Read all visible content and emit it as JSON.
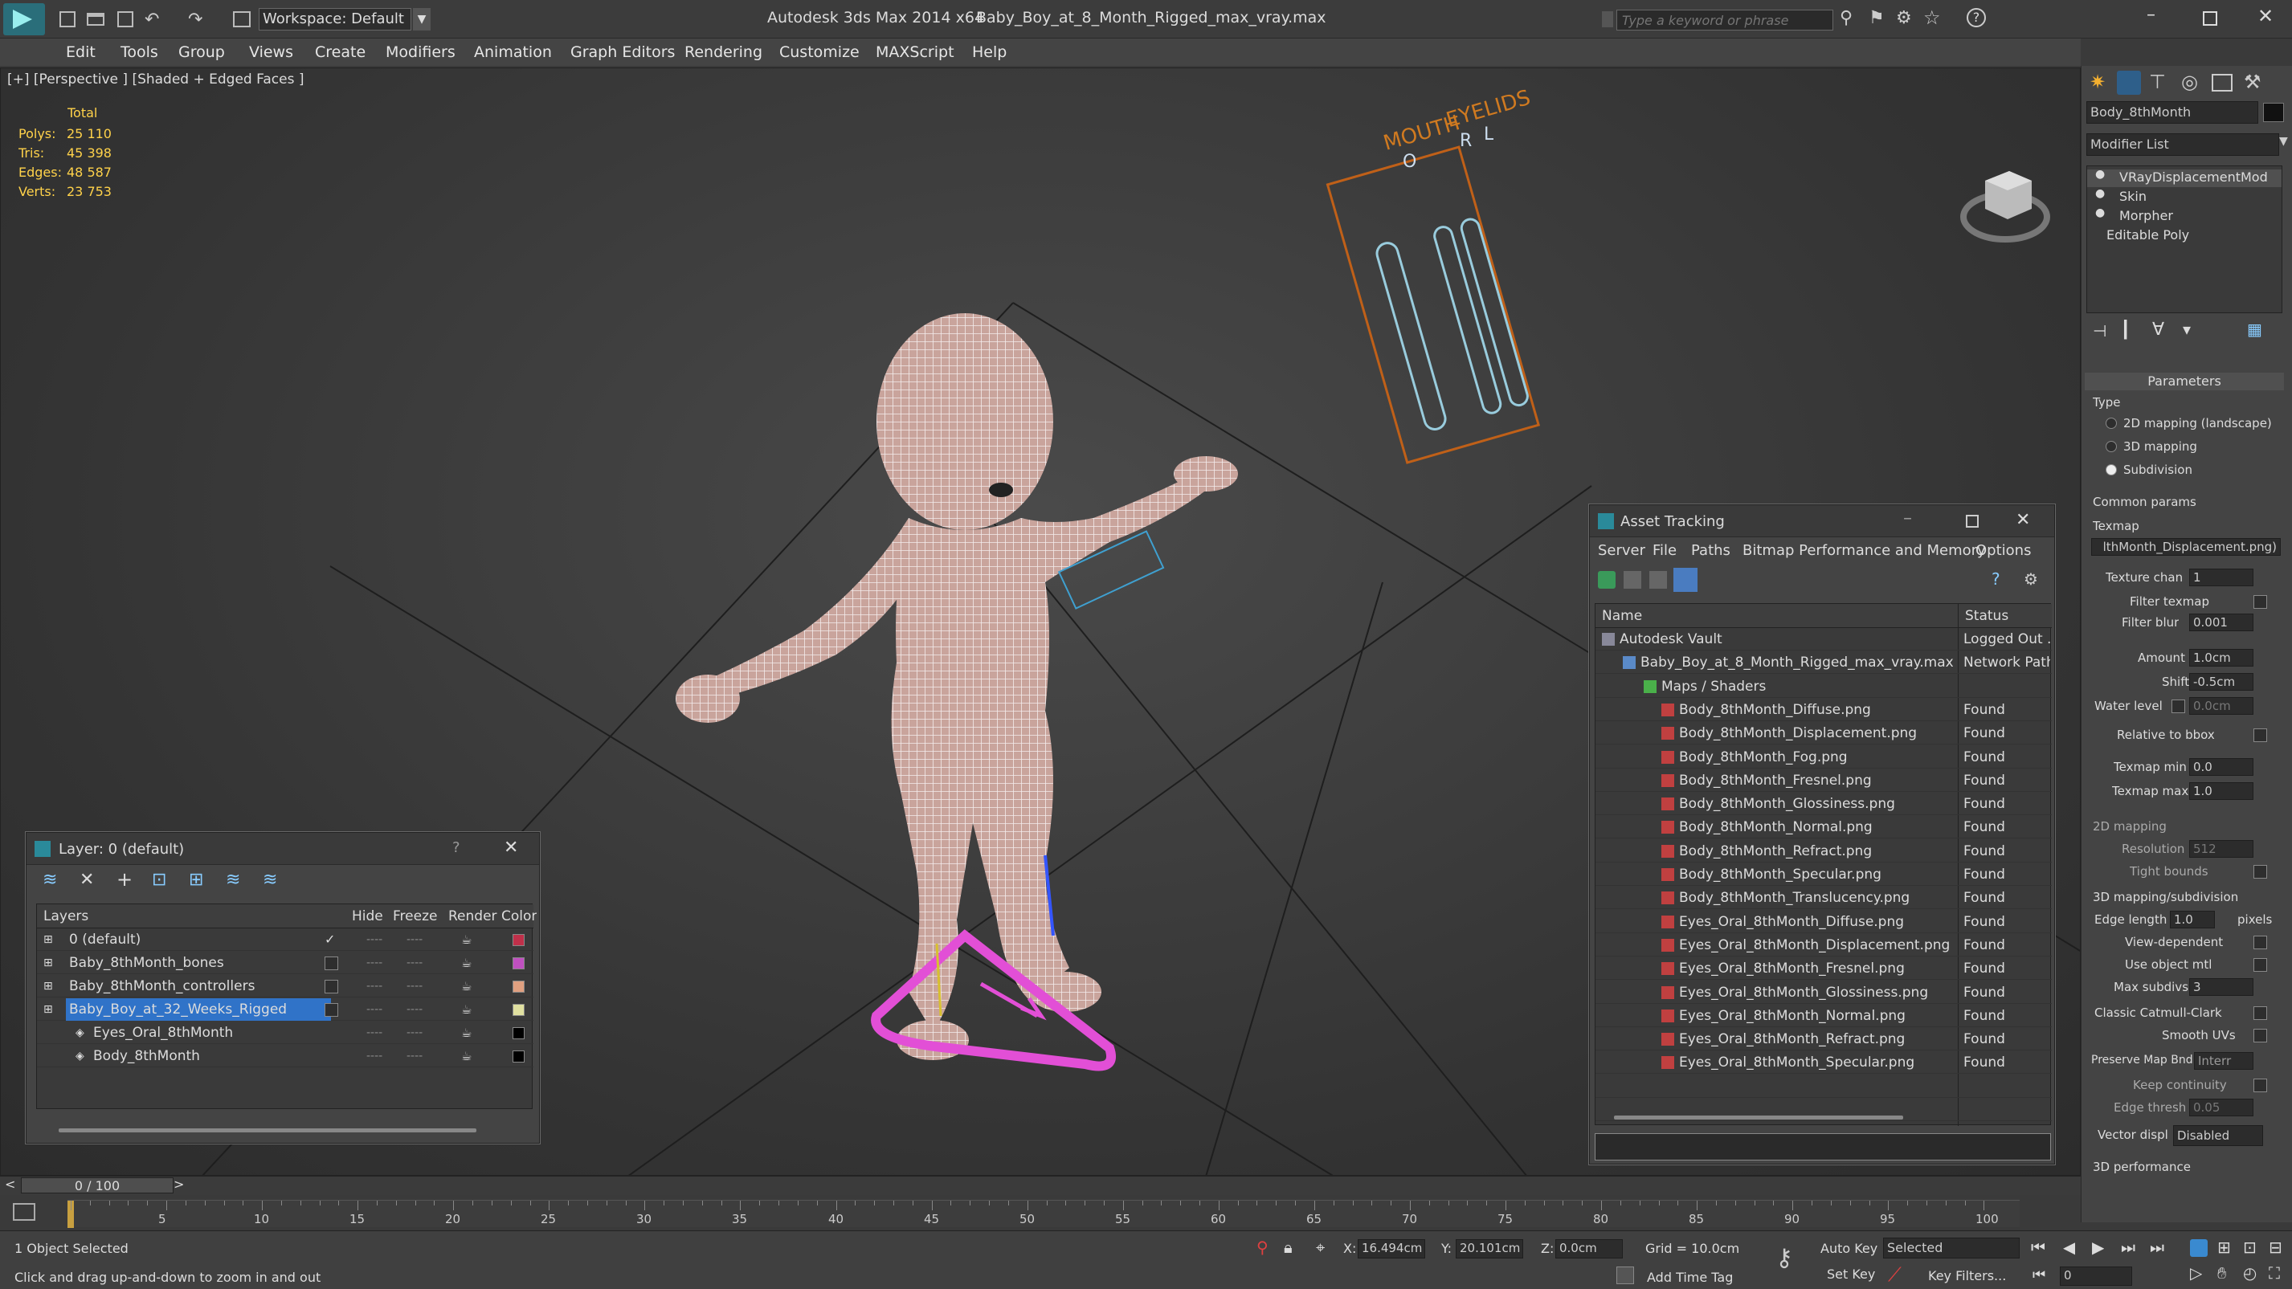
{
  "app": {
    "title": "Autodesk 3ds Max  2014 x64",
    "file": "Baby_Boy_at_8_Month_Rigged_max_vray.max",
    "workspace": "Workspace: Default",
    "search_placeholder": "Type a keyword or phrase"
  },
  "menu": [
    "Edit",
    "Tools",
    "Group",
    "Views",
    "Create",
    "Modifiers",
    "Animation",
    "Graph Editors",
    "Rendering",
    "Customize",
    "MAXScript",
    "Help"
  ],
  "viewport": {
    "label": "[+] [Perspective ] [Shaded + Edged Faces ]",
    "stats": {
      "total_label": "Total",
      "rows": [
        {
          "label": "Polys:",
          "value": "25 110"
        },
        {
          "label": "Tris:",
          "value": "45 398"
        },
        {
          "label": "Edges:",
          "value": "48 587"
        },
        {
          "label": "Verts:",
          "value": "23 753"
        }
      ]
    },
    "controller_board": {
      "title1": "MOUTH",
      "title2": "EYELIDS",
      "o": "O",
      "r": "R",
      "l": "L"
    }
  },
  "layer_window": {
    "title": "Layer: 0 (default)",
    "help": "?",
    "columns": [
      "Layers",
      "Hide",
      "Freeze",
      "Render",
      "Color"
    ],
    "rows": [
      {
        "name": "0 (default)",
        "indent": 0,
        "color": "#c0304a",
        "checked": true,
        "selected": false
      },
      {
        "name": "Baby_8thMonth_bones",
        "indent": 0,
        "color": "#c050c0",
        "checked": false,
        "selected": false
      },
      {
        "name": "Baby_8thMonth_controllers",
        "indent": 0,
        "color": "#e0a080",
        "checked": false,
        "selected": false
      },
      {
        "name": "Baby_Boy_at_32_Weeks_Rigged",
        "indent": 0,
        "color": "#e0e0a0",
        "checked": false,
        "selected": true
      },
      {
        "name": "Eyes_Oral_8thMonth",
        "indent": 1,
        "color": "#000000",
        "checked": false,
        "selected": false
      },
      {
        "name": "Body_8thMonth",
        "indent": 1,
        "color": "#000000",
        "checked": false,
        "selected": false
      }
    ]
  },
  "asset_window": {
    "title": "Asset Tracking",
    "menu": [
      "Server",
      "File",
      "Paths",
      "Bitmap Performance and Memory",
      "Options"
    ],
    "columns": [
      "Name",
      "Status"
    ],
    "rows": [
      {
        "name": "Autodesk Vault",
        "status": "Logged Out .",
        "indent": 0,
        "kind": "vault"
      },
      {
        "name": "Baby_Boy_at_8_Month_Rigged_max_vray.max",
        "status": "Network Path",
        "indent": 1,
        "kind": "max"
      },
      {
        "name": "Maps / Shaders",
        "status": "",
        "indent": 2,
        "kind": "folder"
      },
      {
        "name": "Body_8thMonth_Diffuse.png",
        "status": "Found",
        "indent": 3,
        "kind": "png"
      },
      {
        "name": "Body_8thMonth_Displacement.png",
        "status": "Found",
        "indent": 3,
        "kind": "png"
      },
      {
        "name": "Body_8thMonth_Fog.png",
        "status": "Found",
        "indent": 3,
        "kind": "png"
      },
      {
        "name": "Body_8thMonth_Fresnel.png",
        "status": "Found",
        "indent": 3,
        "kind": "png"
      },
      {
        "name": "Body_8thMonth_Glossiness.png",
        "status": "Found",
        "indent": 3,
        "kind": "png"
      },
      {
        "name": "Body_8thMonth_Normal.png",
        "status": "Found",
        "indent": 3,
        "kind": "png"
      },
      {
        "name": "Body_8thMonth_Refract.png",
        "status": "Found",
        "indent": 3,
        "kind": "png"
      },
      {
        "name": "Body_8thMonth_Specular.png",
        "status": "Found",
        "indent": 3,
        "kind": "png"
      },
      {
        "name": "Body_8thMonth_Translucency.png",
        "status": "Found",
        "indent": 3,
        "kind": "png"
      },
      {
        "name": "Eyes_Oral_8thMonth_Diffuse.png",
        "status": "Found",
        "indent": 3,
        "kind": "png"
      },
      {
        "name": "Eyes_Oral_8thMonth_Displacement.png",
        "status": "Found",
        "indent": 3,
        "kind": "png"
      },
      {
        "name": "Eyes_Oral_8thMonth_Fresnel.png",
        "status": "Found",
        "indent": 3,
        "kind": "png"
      },
      {
        "name": "Eyes_Oral_8thMonth_Glossiness.png",
        "status": "Found",
        "indent": 3,
        "kind": "png"
      },
      {
        "name": "Eyes_Oral_8thMonth_Normal.png",
        "status": "Found",
        "indent": 3,
        "kind": "png"
      },
      {
        "name": "Eyes_Oral_8thMonth_Refract.png",
        "status": "Found",
        "indent": 3,
        "kind": "png"
      },
      {
        "name": "Eyes_Oral_8thMonth_Specular.png",
        "status": "Found",
        "indent": 3,
        "kind": "png"
      }
    ]
  },
  "command_panel": {
    "object_name": "Body_8thMonth",
    "modifier_list": "Modifier List",
    "stack": [
      "VRayDisplacementMod",
      "Skin",
      "Morpher",
      "Editable Poly"
    ],
    "parameters_title": "Parameters",
    "type_label": "Type",
    "type_options": [
      "2D mapping (landscape)",
      "3D mapping",
      "Subdivision"
    ],
    "common_params": "Common params",
    "texmap_label": "Texmap",
    "texmap_value": "lthMonth_Displacement.png)",
    "texture_chan": {
      "label": "Texture chan",
      "value": "1"
    },
    "filter_texmap": "Filter texmap",
    "filter_blur": {
      "label": "Filter blur",
      "value": "0.001"
    },
    "amount": {
      "label": "Amount",
      "value": "1.0cm"
    },
    "shift": {
      "label": "Shift",
      "value": "-0.5cm"
    },
    "water_level": {
      "label": "Water level",
      "value": "0.0cm"
    },
    "relative_bbox": "Relative to bbox",
    "texmap_min": {
      "label": "Texmap min",
      "value": "0.0"
    },
    "texmap_max": {
      "label": "Texmap max",
      "value": "1.0"
    },
    "mapping2d": "2D mapping",
    "resolution": {
      "label": "Resolution",
      "value": "512"
    },
    "tight_bounds": "Tight bounds",
    "mapping3d": "3D mapping/subdivision",
    "edge_length": {
      "label": "Edge length",
      "value": "1.0",
      "unit": "pixels"
    },
    "view_dependent": "View-dependent",
    "use_object_mtl": "Use object mtl",
    "max_subdivs": {
      "label": "Max subdivs",
      "value": "3"
    },
    "classic_catmull": "Classic Catmull-Clark",
    "smooth_uvs": "Smooth UVs",
    "preserve_map": {
      "label": "Preserve Map Bnd",
      "value": "Interr"
    },
    "keep_continuity": "Keep continuity",
    "edge_thresh": {
      "label": "Edge thresh",
      "value": "0.05"
    },
    "vector_displ": {
      "label": "Vector displ",
      "value": "Disabled"
    },
    "perf3d": "3D performance"
  },
  "timeline": {
    "frame": "0 / 100",
    "ticks": [
      "5",
      "10",
      "15",
      "20",
      "25",
      "30",
      "35",
      "40",
      "45",
      "50",
      "55",
      "60",
      "65",
      "70",
      "75",
      "80",
      "85",
      "90",
      "95",
      "100"
    ]
  },
  "status": {
    "selected": "1 Object Selected",
    "prompt": "Click and drag up-and-down to zoom in and out",
    "x_label": "X:",
    "x": "16.494cm",
    "y_label": "Y:",
    "y": "20.101cm",
    "z_label": "Z:",
    "z": "0.0cm",
    "grid": "Grid = 10.0cm",
    "auto_key": "Auto Key",
    "set_key": "Set Key",
    "selected_dropdown": "Selected",
    "key_filters": "Key Filters...",
    "add_time_tag": "Add Time Tag",
    "frame_field": "0"
  }
}
